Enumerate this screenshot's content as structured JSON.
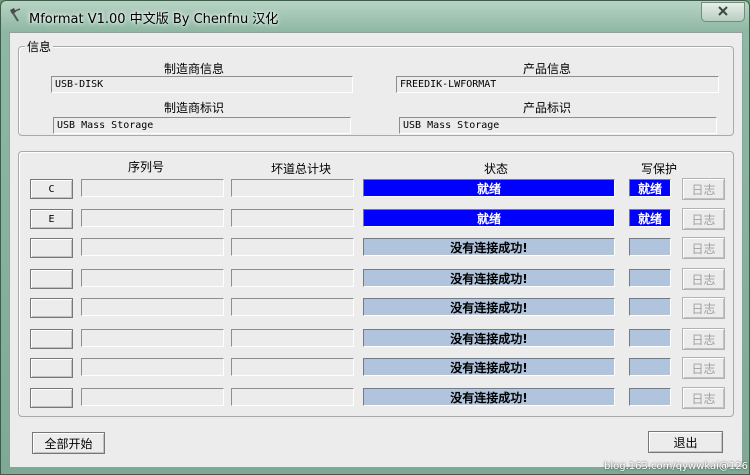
{
  "window": {
    "title": "Mformat V1.00 中文版 By Chenfnu 汉化"
  },
  "info": {
    "legend": "信息",
    "manufacturer_info_label": "制造商信息",
    "manufacturer_info_value": "USB-DISK",
    "product_info_label": "产品信息",
    "product_info_value": "FREEDIK-LWFORMAT",
    "manufacturer_id_label": "制造商标识",
    "manufacturer_id_value": "USB Mass Storage",
    "product_id_label": "产品标识",
    "product_id_value": "USB Mass Storage"
  },
  "table": {
    "headers": {
      "serial": "序列号",
      "bad_blocks": "坏道总计块",
      "status": "状态",
      "write_protect": "写保护"
    },
    "log_label": "日志",
    "rows": [
      {
        "drive": "C",
        "status": "就绪",
        "wp": "就绪",
        "state": "ready"
      },
      {
        "drive": "E",
        "status": "就绪",
        "wp": "就绪",
        "state": "ready"
      },
      {
        "drive": "",
        "status": "没有连接成功!",
        "wp": "",
        "state": "off"
      },
      {
        "drive": "",
        "status": "没有连接成功!",
        "wp": "",
        "state": "off"
      },
      {
        "drive": "",
        "status": "没有连接成功!",
        "wp": "",
        "state": "off"
      },
      {
        "drive": "",
        "status": "没有连接成功!",
        "wp": "",
        "state": "off"
      },
      {
        "drive": "",
        "status": "没有连接成功!",
        "wp": "",
        "state": "off"
      },
      {
        "drive": "",
        "status": "没有连接成功!",
        "wp": "",
        "state": "off"
      }
    ]
  },
  "buttons": {
    "start_all": "全部开始",
    "exit": "退出"
  },
  "watermark": "blog.163.com/qywwkai@126",
  "colors": {
    "ready": "#0000ff",
    "disconnected": "#b0c4de"
  },
  "icons": {
    "app": "usb-plug-icon",
    "close": "close-x-icon"
  }
}
